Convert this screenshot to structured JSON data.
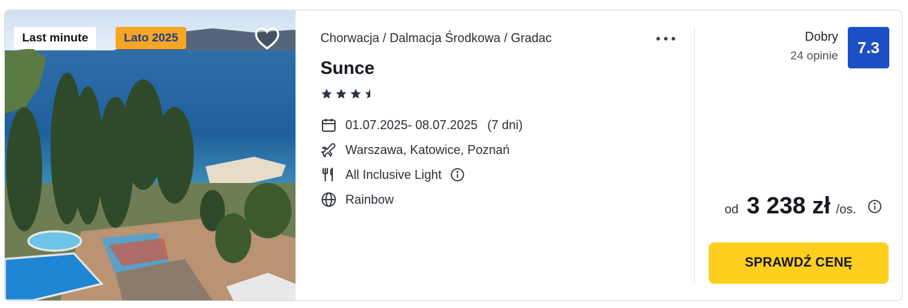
{
  "badges": {
    "last_minute": "Last minute",
    "season": "Lato 2025"
  },
  "breadcrumb": "Chorwacja / Dalmacja Środkowa / Gradac",
  "hotel": {
    "name": "Sunce",
    "stars": 3.5
  },
  "details": {
    "dates": "01.07.2025- 08.07.2025",
    "duration": "(7 dni)",
    "departures": "Warszawa, Katowice, Poznań",
    "board": "All Inclusive Light",
    "operator": "Rainbow"
  },
  "rating": {
    "label": "Dobry",
    "count": "24 opinie",
    "score": "7.3"
  },
  "price": {
    "prefix": "od",
    "value": "3 238 zł",
    "suffix": "/os."
  },
  "cta": "SPRAWDŹ CENĘ",
  "icons": {
    "favorite": "heart-icon",
    "more": "more-icon",
    "calendar": "calendar-icon",
    "plane": "plane-icon",
    "board": "cutlery-icon",
    "operator": "globe-icon",
    "info": "info-icon"
  },
  "colors": {
    "score_bg": "#1d4fc4",
    "cta_bg": "#fecf1f",
    "season_badge_bg": "#f5a623",
    "season_badge_text": "#1f3d8c"
  }
}
